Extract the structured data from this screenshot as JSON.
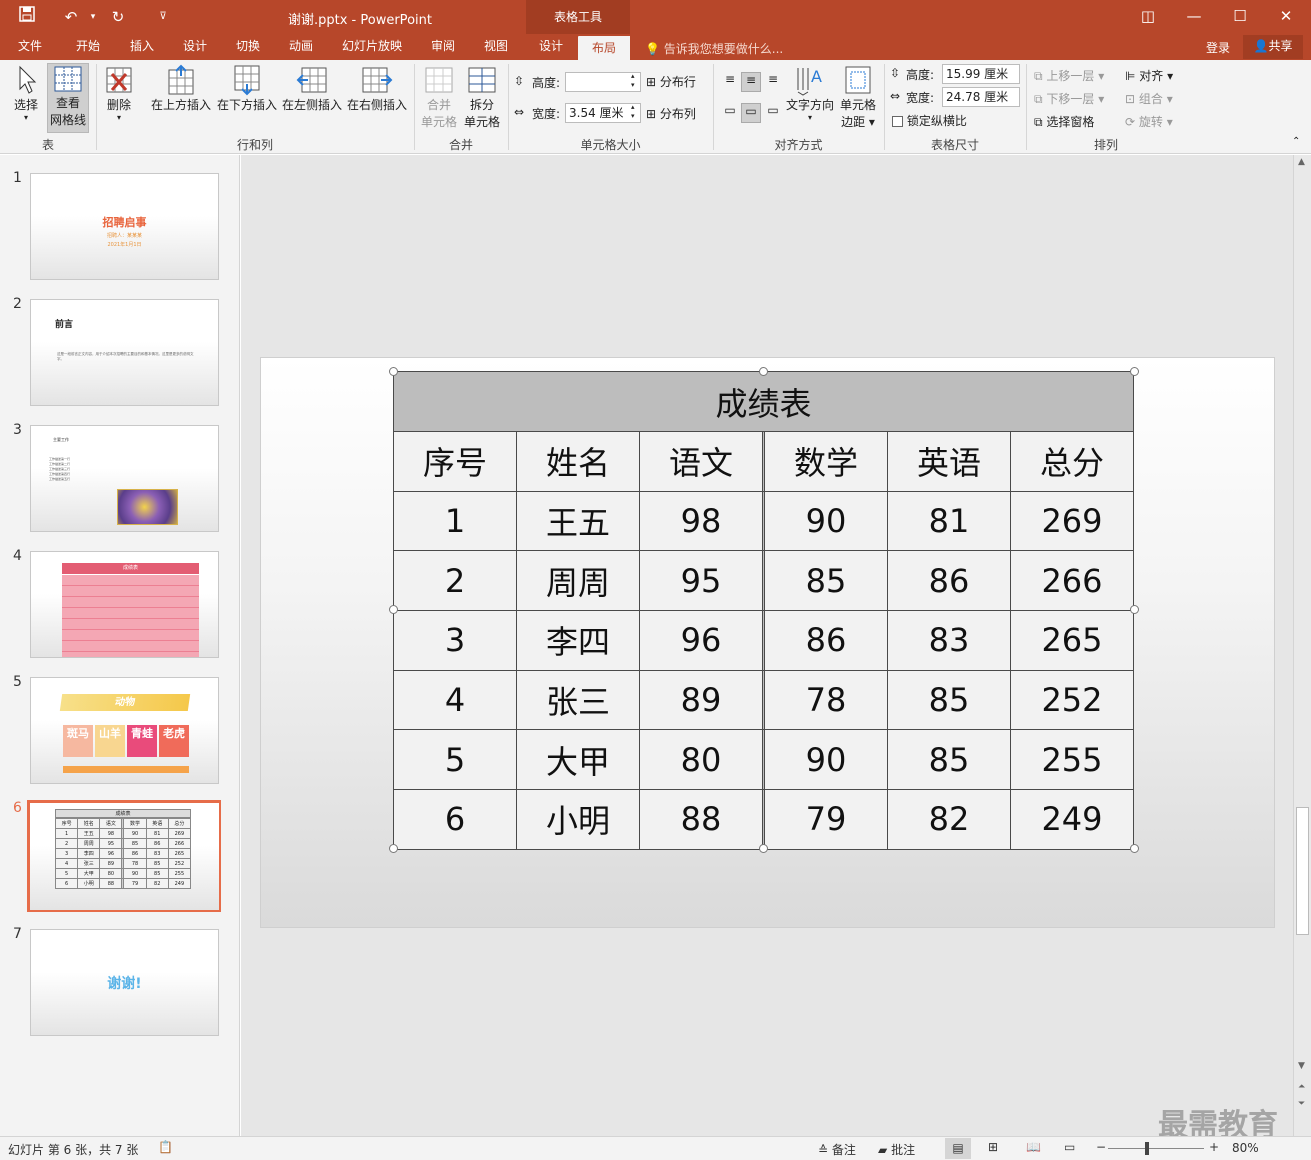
{
  "titlebar": {
    "doc_title": "谢谢.pptx - PowerPoint",
    "context_tab": "表格工具",
    "controls": {
      "ribbon_options": "◫",
      "minimize": "—",
      "maximize": "☐",
      "close": "✕"
    }
  },
  "tabs": [
    "文件",
    "开始",
    "插入",
    "设计",
    "切换",
    "动画",
    "幻灯片放映",
    "审阅",
    "视图",
    "设计",
    "布局"
  ],
  "tell_me": "告诉我您想要做什么...",
  "signin": "登录",
  "share": "共享",
  "ribbon": {
    "select": "选择",
    "view_gridlines": [
      "查看",
      "网格线"
    ],
    "delete": "删除",
    "insert_above": "在上方插入",
    "insert_below": "在下方插入",
    "insert_left": "在左侧插入",
    "insert_right": "在右侧插入",
    "merge_cells": [
      "合并",
      "单元格"
    ],
    "split_cells": [
      "拆分",
      "单元格"
    ],
    "height_label": "高度:",
    "height_value": "",
    "width_label": "宽度:",
    "width_value": "3.54 厘米",
    "distribute_rows": "分布行",
    "distribute_cols": "分布列",
    "text_direction": "文字方向",
    "cell_margins": [
      "单元格",
      "边距"
    ],
    "tbl_height_label": "高度:",
    "tbl_height_value": "15.99 厘米",
    "tbl_width_label": "宽度:",
    "tbl_width_value": "24.78 厘米",
    "lock_ratio": "锁定纵横比",
    "bring_forward": "上移一层",
    "send_backward": "下移一层",
    "selection_pane": "选择窗格",
    "align": "对齐",
    "group": "组合",
    "rotate": "旋转",
    "groups": [
      "表",
      "行和列",
      "合并",
      "单元格大小",
      "对齐方式",
      "表格尺寸",
      "排列"
    ]
  },
  "thumbnails": {
    "numbers": [
      "1",
      "2",
      "3",
      "4",
      "5",
      "6",
      "7"
    ],
    "s1_title": "招聘启事",
    "s1_sub": "招聘人：某某某",
    "s1_date": "2021年1月1日",
    "s2_title": "前言",
    "s2_body": "这是一段前言正文内容，用于介绍本次招聘的主要目的和基本情况。这里是更多的说明文字。",
    "s3_title": "主要工作",
    "s3_lines": [
      "工作描述第一行",
      "工作描述第二行",
      "工作描述第三行",
      "工作描述第四行",
      "工作描述第五行"
    ],
    "s4_title": "成绩表",
    "s5_title": "动物",
    "s5_cards": [
      "斑马",
      "山羊",
      "青蛙",
      "老虎"
    ],
    "s6_title": "成绩表",
    "s7_title": "谢谢!"
  },
  "table": {
    "title": "成绩表",
    "headers": [
      "序号",
      "姓名",
      "语文",
      "",
      "数学",
      "英语",
      "总分"
    ],
    "rows": [
      [
        "1",
        "王五",
        "98",
        "",
        "90",
        "81",
        "269"
      ],
      [
        "2",
        "周周",
        "95",
        "",
        "85",
        "86",
        "266"
      ],
      [
        "3",
        "李四",
        "96",
        "",
        "86",
        "83",
        "265"
      ],
      [
        "4",
        "张三",
        "89",
        "",
        "78",
        "85",
        "252"
      ],
      [
        "5",
        "大甲",
        "80",
        "",
        "90",
        "85",
        "255"
      ],
      [
        "6",
        "小明",
        "88",
        "",
        "79",
        "82",
        "249"
      ]
    ]
  },
  "status": {
    "slide_info": "幻灯片 第 6 张，共 7 张",
    "notes": "备注",
    "comments": "批注",
    "zoom": "80%",
    "zoom_fraction": 0.4
  },
  "watermark": "最需教育"
}
